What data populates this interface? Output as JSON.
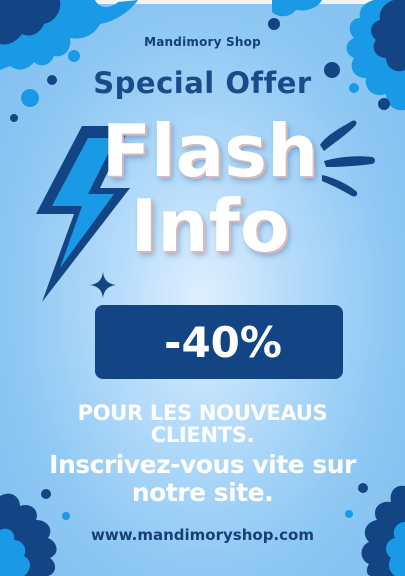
{
  "brand": "Mandimory Shop",
  "headline": "Special Offer",
  "title": {
    "line1": "Flash",
    "line2": "Info"
  },
  "discount": "-40%",
  "audience": "POUR LES NOUVEAUS CLIENTS.",
  "call_to_action": "Inscrivez-vous vite sur notre site.",
  "website": "www.mandimoryshop.com",
  "colors": {
    "navy": "#134483",
    "bright_blue": "#1a9ae6",
    "sky_blue": "#8ec8f4",
    "text_blue": "#1b4a8b",
    "white": "#ffffff"
  },
  "icons": [
    "paint-splash-icon",
    "lightning-bolt-icon",
    "sparkle-icon",
    "burst-lines-icon"
  ]
}
